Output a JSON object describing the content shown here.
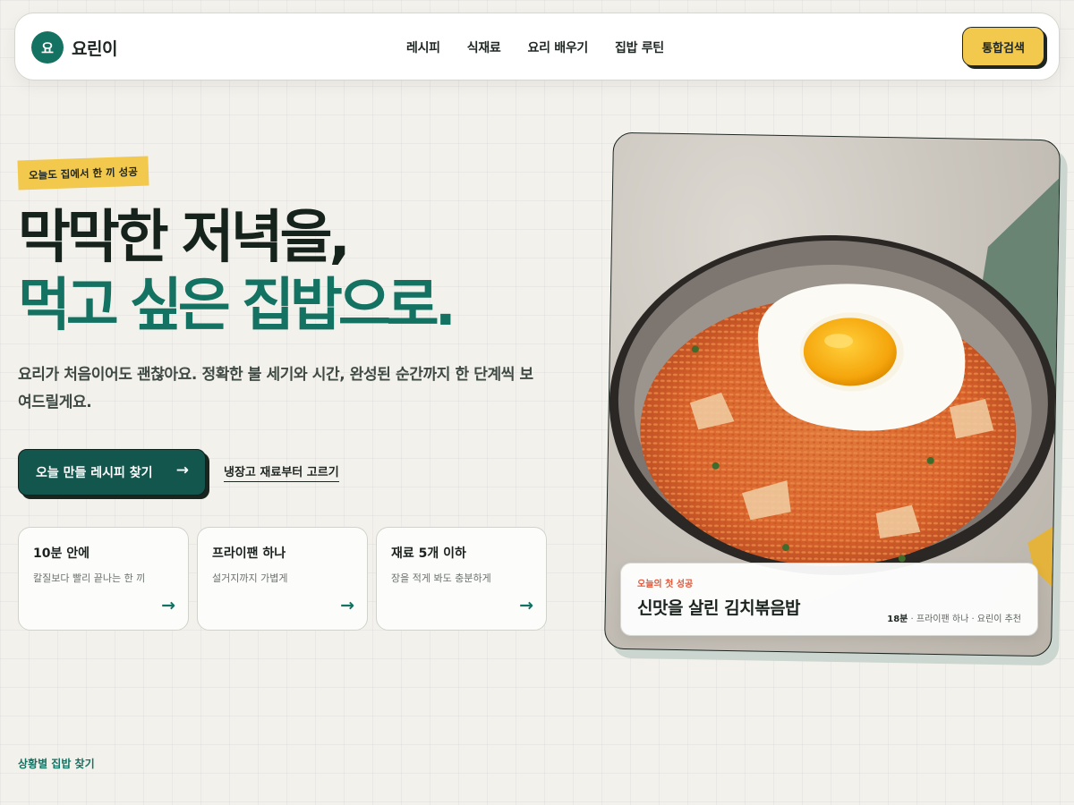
{
  "header": {
    "logo_mark": "요",
    "logo_text": "요린이",
    "nav": [
      "레시피",
      "식재료",
      "요리 배우기",
      "집밥 루틴"
    ],
    "search_label": "통합검색"
  },
  "hero": {
    "tag": "오늘도 집에서 한 끼 성공",
    "headline_line1": "막막한 저녁을,",
    "headline_line2": "먹고 싶은 집밥으로.",
    "lead": "요리가 처음이어도 괜찮아요. 정확한 불 세기와 시간, 완성된 순간까지 한 단계씩 보여드릴게요.",
    "cta_label": "오늘 만들 레시피 찾기",
    "cta_arrow": "→",
    "sublink": "냉장고 재료부터 고르기"
  },
  "cards": [
    {
      "title": "10분 안에",
      "desc": "칼질보다 빨리 끝나는 한 끼",
      "arrow": "→"
    },
    {
      "title": "프라이팬 하나",
      "desc": "설거지까지 가볍게",
      "arrow": "→"
    },
    {
      "title": "재료 5개 이하",
      "desc": "장을 적게 봐도 충분하게",
      "arrow": "→"
    }
  ],
  "feature": {
    "kicker": "오늘의 첫 성공",
    "title": "신맛을 살린 김치볶음밥",
    "meta_time": "18분",
    "meta_rest": " · 프라이팬 하나 · 요린이 추천"
  },
  "section_label": "상황별 집밥 찾기",
  "colors": {
    "brand": "#137262",
    "accent": "#f2c94c",
    "cta_bg": "#13564e",
    "kicker": "#e0573a"
  }
}
